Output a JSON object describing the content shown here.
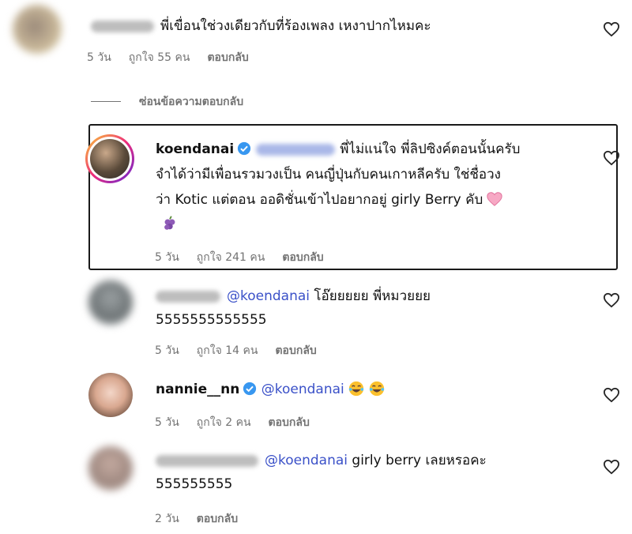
{
  "comments": [
    {
      "id": "c1",
      "text": "พี่เขื่อนใช่วงเดียวกับที่ร้องเพลง เหงาปากไหมคะ",
      "time": "5 วัน",
      "likes": "ถูกใจ 55 คน",
      "reply": "ตอบกลับ"
    },
    {
      "id": "c2",
      "username": "koendanai",
      "line1": "พี่ไม่แน่ใจ พี่ลิปซิงค์ตอนนั้นครับ",
      "line2": "จำได้ว่ามีเพื่อนรวมวงเป็น คนญี่ปุ่นกับคนเกาหลีครับ ใช่ชื่อวง",
      "line3": "ว่า Kotic แต่ตอน ออดิชั่นเข้าไปอยากอยู่ girly Berry คับ",
      "time": "5 วัน",
      "likes": "ถูกใจ 241 คน",
      "reply": "ตอบกลับ"
    },
    {
      "id": "c3",
      "mention": "@koendanai",
      "text": "โอ๊ยยยยย พี่หมวยยย",
      "line2": "5555555555555",
      "time": "5 วัน",
      "likes": "ถูกใจ 14 คน",
      "reply": "ตอบกลับ"
    },
    {
      "id": "c4",
      "username": "nannie__nn",
      "mention": "@koendanai",
      "time": "5 วัน",
      "likes": "ถูกใจ 2 คน",
      "reply": "ตอบกลับ"
    },
    {
      "id": "c5",
      "mention": "@koendanai",
      "text": "girly berry เลยหรอคะ",
      "line2": "555555555",
      "time": "2 วัน",
      "reply": "ตอบกลับ"
    }
  ],
  "hide_replies": "ซ่อนข้อความตอบกลับ",
  "colors": {
    "mention": "#3b51c8",
    "verified": "#3897f0",
    "meta": "#737373"
  }
}
